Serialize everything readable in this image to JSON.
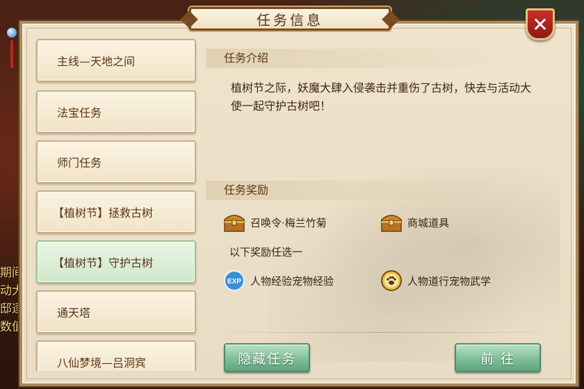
{
  "dialog": {
    "title": "任务信息",
    "close_icon": "close-icon"
  },
  "task_list": [
    {
      "label": "主线—天地之间",
      "active": false
    },
    {
      "label": "法宝任务",
      "active": false
    },
    {
      "label": "师门任务",
      "active": false
    },
    {
      "label": "【植树节】拯救古树",
      "active": false
    },
    {
      "label": "【植树节】守护古树",
      "active": true
    },
    {
      "label": "通天塔",
      "active": false
    },
    {
      "label": "八仙梦境—吕洞宾",
      "active": false
    }
  ],
  "content": {
    "intro_heading": "任务介绍",
    "intro_text": "植树节之际，妖魔大肆入侵袭击并重伤了古树，快去与活动大使一起守护古树吧！",
    "rewards_heading": "任务奖励",
    "rewards": [
      {
        "label": "召唤令·梅兰竹菊",
        "icon": "treasure-chest-icon"
      },
      {
        "label": "商城道具",
        "icon": "treasure-chest-icon"
      }
    ],
    "choose_one_text": "以下奖励任选一",
    "choice_rewards": [
      {
        "label": "人物经验宠物经验",
        "icon": "exp-icon",
        "icon_text": "EXP"
      },
      {
        "label": "人物道行宠物武学",
        "icon": "paw-coin-icon"
      }
    ]
  },
  "buttons": {
    "hide_task": "隐藏任务",
    "go": "前 往"
  },
  "background": {
    "chat_fragments": [
      "期间",
      "动大",
      "邸逐",
      "数值"
    ]
  },
  "colors": {
    "parchment": "#efe3cc",
    "text_brown": "#5a3418",
    "active_green": "#cfe7cb",
    "button_green": "#7fbf98",
    "close_red": "#c7312a"
  }
}
